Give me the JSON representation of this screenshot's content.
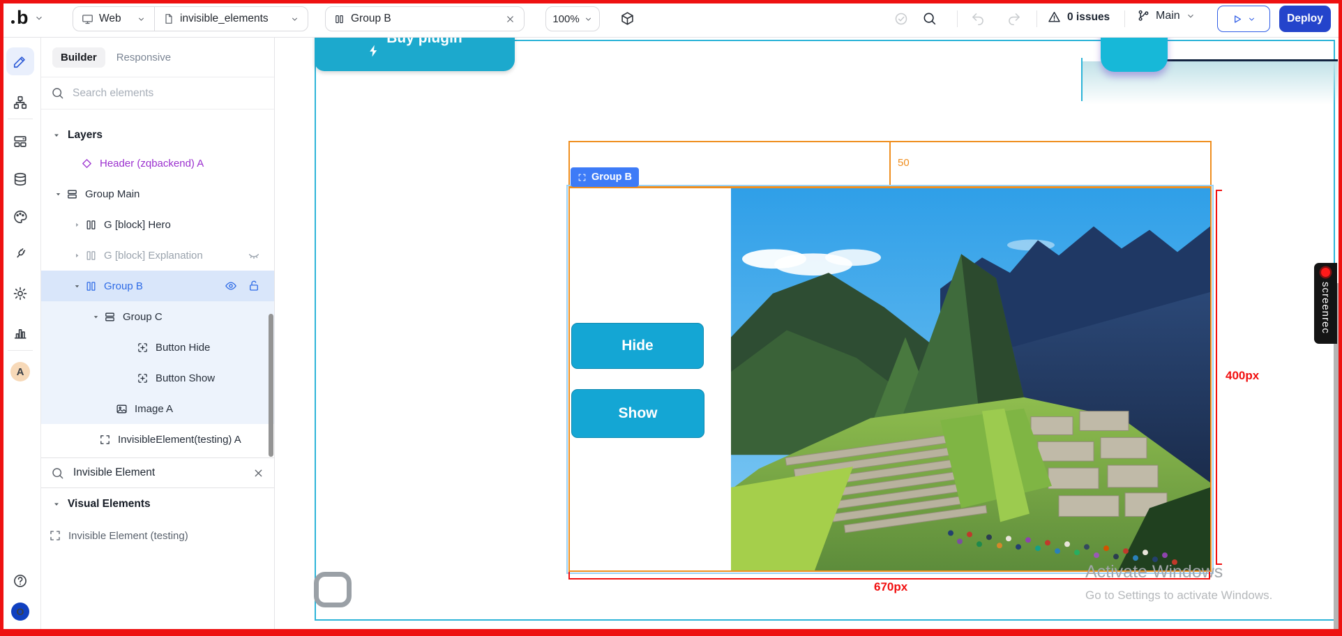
{
  "toolbar": {
    "logo": "b",
    "device": {
      "label": "Web"
    },
    "page": {
      "label": "invisible_elements"
    },
    "tab": {
      "label": "Group B"
    },
    "zoom": {
      "label": "100%"
    },
    "issues": {
      "label": "0 issues"
    },
    "branch": {
      "label": "Main"
    },
    "deploy": {
      "label": "Deploy"
    }
  },
  "rail": {
    "items": [
      {
        "name": "edit-pencil-icon",
        "active": true
      },
      {
        "name": "sitemap-icon"
      },
      {
        "name": "divider"
      },
      {
        "name": "models-icon"
      },
      {
        "name": "database-icon"
      },
      {
        "name": "palette-icon"
      },
      {
        "name": "plug-icon"
      },
      {
        "name": "settings-gear-icon"
      },
      {
        "name": "analytics-chart-icon"
      },
      {
        "name": "divider"
      },
      {
        "name": "avatar",
        "label": "A"
      }
    ],
    "bottom": {
      "help": "?",
      "org_badge": "O"
    }
  },
  "left_panel": {
    "tabs": [
      {
        "label": "Builder",
        "active": true
      },
      {
        "label": "Responsive",
        "active": false
      }
    ],
    "search_placeholder": "Search elements",
    "layers_title": "Layers",
    "layers": [
      {
        "label": "Header (zqbackend) A",
        "icon": "diamond-icon",
        "caret": null,
        "pad": 38,
        "color": "purple",
        "bg": null,
        "trailing": []
      },
      {
        "label": "Group Main",
        "icon": "rows-icon",
        "caret": "down",
        "pad": 17,
        "color": "dark",
        "bg": null,
        "trailing": []
      },
      {
        "label": "G [block] Hero",
        "icon": "columns-icon",
        "caret": "right",
        "pad": 44,
        "color": "dark",
        "bg": null,
        "trailing": []
      },
      {
        "label": "G [block] Explanation",
        "icon": "columns-icon",
        "caret": "right",
        "pad": 44,
        "color": "gray",
        "bg": null,
        "trailing": [
          "eye-off-icon"
        ]
      },
      {
        "label": "Group B",
        "icon": "columns-icon",
        "caret": "down",
        "pad": 44,
        "color": "blue",
        "bg": "selected",
        "trailing": [
          "eye-icon",
          "lock-open-icon"
        ]
      },
      {
        "label": "Group C",
        "icon": "rows-icon",
        "caret": "down",
        "pad": 71,
        "color": "dark",
        "bg": "subtree",
        "trailing": []
      },
      {
        "label": "Button Hide",
        "icon": "button-plus-icon",
        "caret": null,
        "pad": 118,
        "color": "dark",
        "bg": "subtree",
        "trailing": []
      },
      {
        "label": "Button Show",
        "icon": "button-plus-icon",
        "caret": null,
        "pad": 118,
        "color": "dark",
        "bg": "subtree",
        "trailing": []
      },
      {
        "label": "Image A",
        "icon": "image-icon",
        "caret": null,
        "pad": 88,
        "color": "dark",
        "bg": "subtree",
        "trailing": []
      },
      {
        "label": "InvisibleElement(testing) A",
        "icon": "corners-icon",
        "caret": null,
        "pad": 64,
        "color": "dark",
        "bg": null,
        "trailing": []
      }
    ],
    "insert_search_value": "Invisible Element",
    "visual_elements_title": "Visual Elements",
    "visual_elements": [
      {
        "label": "Invisible Element (testing)",
        "icon": "corners-icon"
      }
    ]
  },
  "canvas": {
    "buy_plugin_label": "Buy plugin",
    "selection": {
      "badge_label": "Group B",
      "margin_value": "50",
      "height_label": "400px",
      "width_label": "670px"
    },
    "hide_button_label": "Hide",
    "show_button_label": "Show",
    "image_alt": "Machu Picchu photograph"
  },
  "overlays": {
    "screenrec_label": "screenrec",
    "activate_title": "Activate Windows",
    "activate_subtitle": "Go to Settings to activate Windows."
  },
  "colors": {
    "accent_blue": "#3d7bf7",
    "cyan_button": "#14a6d4",
    "selection_orange": "#ef8e1f",
    "measure_red": "#f10f0f",
    "deploy_blue": "#2444cb",
    "artboard_teal": "#2cb4d8",
    "layer_selected_bg": "#d9e6fa"
  }
}
